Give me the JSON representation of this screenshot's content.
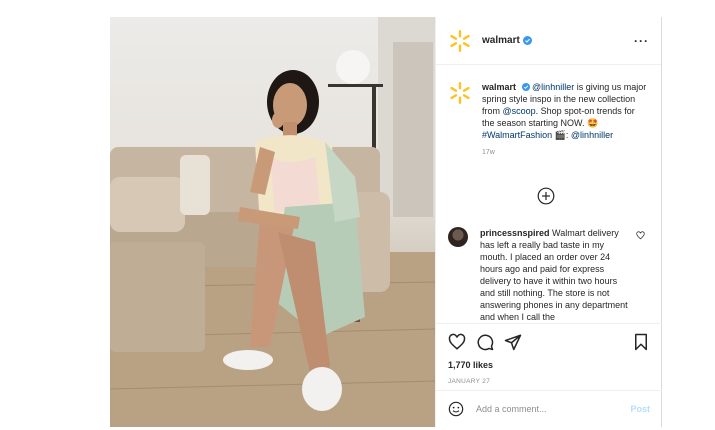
{
  "post": {
    "username": "walmart",
    "caption": {
      "username": "walmart",
      "mention1": "@linhniller",
      "text1": " is giving us major spring style inspo in the new collection from ",
      "mention2": "@scoop",
      "text2": ". Shop spot-on trends for the season starting NOW. 🤩 ",
      "hashtag": "#WalmartFashion",
      "text3": " 🎬: ",
      "mention3": "@linhniller"
    },
    "caption_age": "17w",
    "comment": {
      "username": "princessnspired",
      "text": " Walmart delivery has left a really bad taste in my mouth. I placed an order over 24 hours ago and paid for express delivery to have it within two hours and still nothing. The store is not answering phones in any department and when I call the"
    },
    "likes": "1,770 likes",
    "date": "JANUARY 27",
    "add_comment_placeholder": "Add a comment...",
    "post_button": "Post",
    "more": "···"
  },
  "icons": {
    "header_avatar": "walmart-spark-icon",
    "verified": "verified-badge-icon",
    "load_more": "plus-circle-icon",
    "like": "heart-icon",
    "comment": "comment-icon",
    "share": "paper-plane-icon",
    "save": "bookmark-icon",
    "emoji": "emoji-icon"
  },
  "colors": {
    "walmart_spark": "#ffc220",
    "verified": "#3897f0",
    "link": "#00376b",
    "post_button": "#b2dffc"
  }
}
